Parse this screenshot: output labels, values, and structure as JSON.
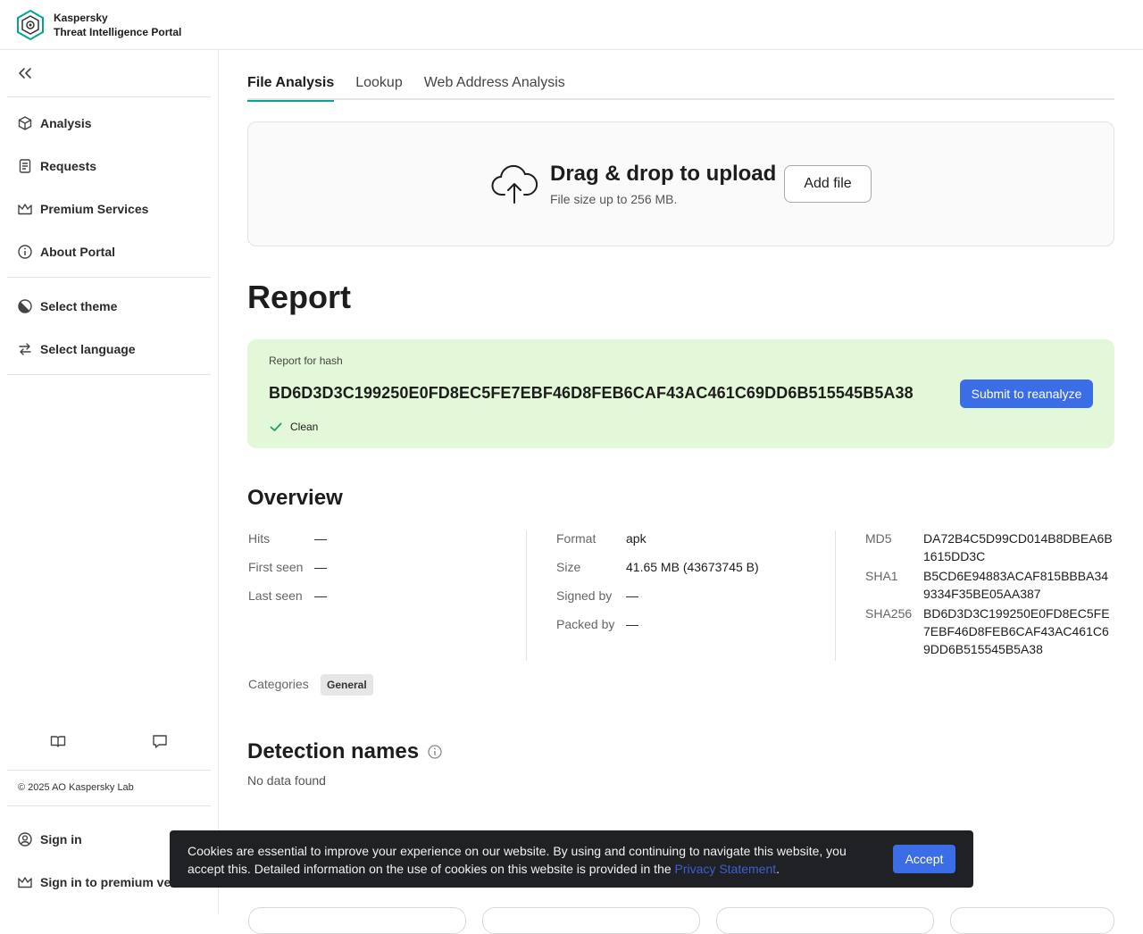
{
  "brand": {
    "name": "Kaspersky",
    "product": "Threat Intelligence Portal"
  },
  "sidebar": {
    "items": [
      {
        "label": "Analysis",
        "icon": "cube-icon"
      },
      {
        "label": "Requests",
        "icon": "document-icon"
      },
      {
        "label": "Premium Services",
        "icon": "crown-icon"
      },
      {
        "label": "About Portal",
        "icon": "info-icon"
      }
    ],
    "settings": [
      {
        "label": "Select theme",
        "icon": "theme-icon"
      },
      {
        "label": "Select language",
        "icon": "language-icon"
      }
    ],
    "footer_icons": [
      "book-icon",
      "chat-icon"
    ],
    "copyright": "© 2025 AO Kaspersky Lab",
    "account": [
      {
        "label": "Sign in",
        "icon": "user-icon"
      },
      {
        "label": "Sign in to premium version",
        "icon": "crown-icon"
      }
    ]
  },
  "tabs": [
    {
      "label": "File Analysis",
      "active": true
    },
    {
      "label": "Lookup",
      "active": false
    },
    {
      "label": "Web Address Analysis",
      "active": false
    }
  ],
  "upload": {
    "title": "Drag & drop to upload",
    "subtitle": "File size up to 256 MB.",
    "button": "Add file"
  },
  "report": {
    "title": "Report",
    "hash_label": "Report for hash",
    "hash": "BD6D3D3C199250E0FD8EC5FE7EBF46D8FEB6CAF43AC461C69DD6B515545B5A38",
    "status": "Clean",
    "reanalyze_button": "Submit to reanalyze",
    "card_color": "#e3f7d9"
  },
  "overview": {
    "title": "Overview",
    "col1": [
      {
        "key": "Hits",
        "value": "—"
      },
      {
        "key": "First seen",
        "value": "—"
      },
      {
        "key": "Last seen",
        "value": "—"
      }
    ],
    "col2": [
      {
        "key": "Format",
        "value": "apk"
      },
      {
        "key": "Size",
        "value": "41.65 MB (43673745 B)"
      },
      {
        "key": "Signed by",
        "value": "—"
      },
      {
        "key": "Packed by",
        "value": "—"
      }
    ],
    "hashes": [
      {
        "key": "MD5",
        "value": "DA72B4C5D99CD014B8DBEA6B1615DD3C"
      },
      {
        "key": "SHA1",
        "value": "B5CD6E94883ACAF815BBBA349334F35BE05AA387"
      },
      {
        "key": "SHA256",
        "value": "BD6D3D3C199250E0FD8EC5FE7EBF46D8FEB6CAF43AC461C69DD6B515545B5A38"
      }
    ],
    "categories_label": "Categories",
    "categories": [
      "General"
    ]
  },
  "detection": {
    "title": "Detection names",
    "empty": "No data found"
  },
  "cookie": {
    "text_before": "Cookies are essential to improve your experience on our website. By using and continuing to navigate this website, you accept this. Detailed information on the use of cookies on this website is provided in the ",
    "link": "Privacy Statement",
    "text_after": ".",
    "accept": "Accept"
  },
  "colors": {
    "accent": "#00a88e",
    "primary_button": "#3b6ee6",
    "clean": "#1b9e73"
  }
}
